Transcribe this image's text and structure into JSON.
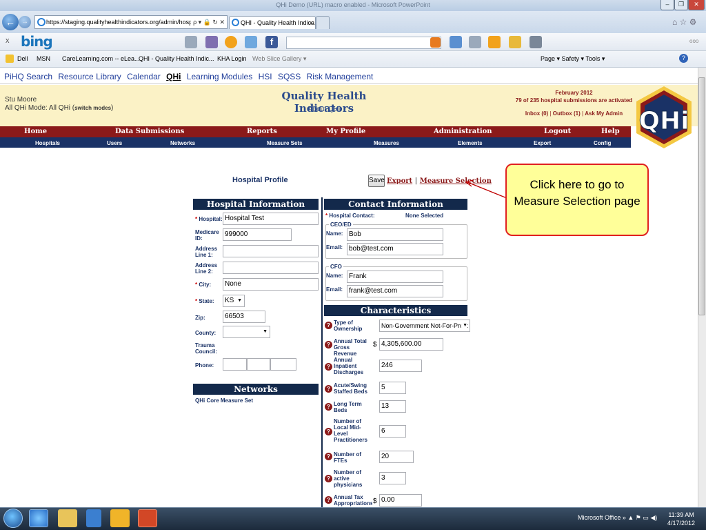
{
  "window": {
    "title": "QHi Demo (URL) macro enabled - Microsoft PowerPoint"
  },
  "browser": {
    "address": "https://staging.qualityhealthindicators.org/admin/hospitals/e",
    "address_controls": "ρ ▾ 🔒 ↻ ✕",
    "tab_active": "QHI - Quality Health Indica...",
    "tab_close": "×",
    "search_brand": "bing",
    "favorites": [
      "Dell",
      "MSN",
      "CareLearning.com -- eLea...",
      "QHI - Quality Health Indic...",
      "KHA Login",
      "Web Slice Gallery ▾"
    ],
    "command_bar": "Page ▾   Safety ▾   Tools ▾"
  },
  "top_links": [
    "PiHQ Search",
    "Resource Library",
    "Calendar",
    "QHi",
    "Learning Modules",
    "HSI",
    "SQSS",
    "Risk Management"
  ],
  "header": {
    "user_name": "Stu Moore",
    "mode_prefix": "All QHi Mode: All QHi (",
    "switch_modes": "switch modes",
    "mode_suffix": ")",
    "app_title": "Quality Health Indicators",
    "about": "About QHi",
    "period": "February 2012",
    "activation": "79 of 235 hospital submissions are activated",
    "inbox": "Inbox (0)",
    "outbox": "Outbox (1)",
    "ask": "Ask My Admin",
    "logo_text": "QHi"
  },
  "main_nav": [
    "Home",
    "Data Submissions",
    "Reports",
    "My Profile",
    "Administration",
    "Logout",
    "Help"
  ],
  "sub_nav": [
    "Hospitals",
    "Users",
    "Networks",
    "Measure Sets",
    "Measures",
    "Elements",
    "Export",
    "Config"
  ],
  "page": {
    "title": "Hospital Profile",
    "save": "Save",
    "export": "Export",
    "separator": "|",
    "measure_selection": "Measure Selection"
  },
  "hospital_info": {
    "heading": "Hospital Information",
    "fields": [
      {
        "label": "Hospital:",
        "required": true,
        "value": "Hospital Test"
      },
      {
        "label": "Medicare ID:",
        "required": false,
        "value": "999000"
      },
      {
        "label": "Address Line 1:",
        "required": false,
        "value": ""
      },
      {
        "label": "Address Line 2:",
        "required": false,
        "value": ""
      },
      {
        "label": "City:",
        "required": true,
        "value": "None"
      },
      {
        "label": "State:",
        "required": true,
        "value": "KS"
      },
      {
        "label": "Zip:",
        "required": false,
        "value": "66503"
      },
      {
        "label": "County:",
        "required": false,
        "value": ""
      },
      {
        "label": "Trauma Council:",
        "required": false,
        "value": ""
      },
      {
        "label": "Phone:",
        "required": false,
        "value": ""
      }
    ]
  },
  "networks": {
    "heading": "Networks",
    "items": [
      "QHi Core Measure Set"
    ]
  },
  "contact_info": {
    "heading": "Contact Information",
    "hospital_contact_label": "Hospital Contact:",
    "hospital_contact_value": "None Selected",
    "ceo": {
      "group": "CEO/ED",
      "name_label": "Name:",
      "name": "Bob",
      "email_label": "Email:",
      "email": "bob@test.com"
    },
    "cfo": {
      "group": "CFO",
      "name_label": "Name:",
      "name": "Frank",
      "email_label": "Email:",
      "email": "frank@test.com"
    }
  },
  "characteristics": {
    "heading": "Characteristics",
    "items": [
      {
        "label": "Type of Ownership",
        "prefix": "",
        "value": "Non-Government Not-For-Profit"
      },
      {
        "label": "Annual Total Gross Revenue",
        "prefix": "$",
        "value": "4,305,600.00"
      },
      {
        "label": "Annual Inpatient Discharges",
        "prefix": "",
        "value": "246"
      },
      {
        "label": "Acute/Swing Staffed Beds",
        "prefix": "",
        "value": "5"
      },
      {
        "label": "Long Term Beds",
        "prefix": "",
        "value": "13"
      },
      {
        "label": "Number of Local Mid-Level Practitioners",
        "prefix": "",
        "value": "6"
      },
      {
        "label": "Number of FTEs",
        "prefix": "",
        "value": "20"
      },
      {
        "label": "Number of active physicians",
        "prefix": "",
        "value": "3"
      },
      {
        "label": "Annual Tax Appropriations",
        "prefix": "$",
        "value": "0.00"
      }
    ]
  },
  "callout": {
    "text": "Click here to go to Measure Selection page"
  },
  "taskbar": {
    "tray_label": "Microsoft Office",
    "time": "11:39 AM",
    "date": "4/17/2012"
  },
  "colors": {
    "maroon": "#8b1a1a",
    "navy": "#13294b",
    "header_bg": "#fbf2c6",
    "callout_bg": "#ffff99",
    "callout_border": "#e02020"
  }
}
